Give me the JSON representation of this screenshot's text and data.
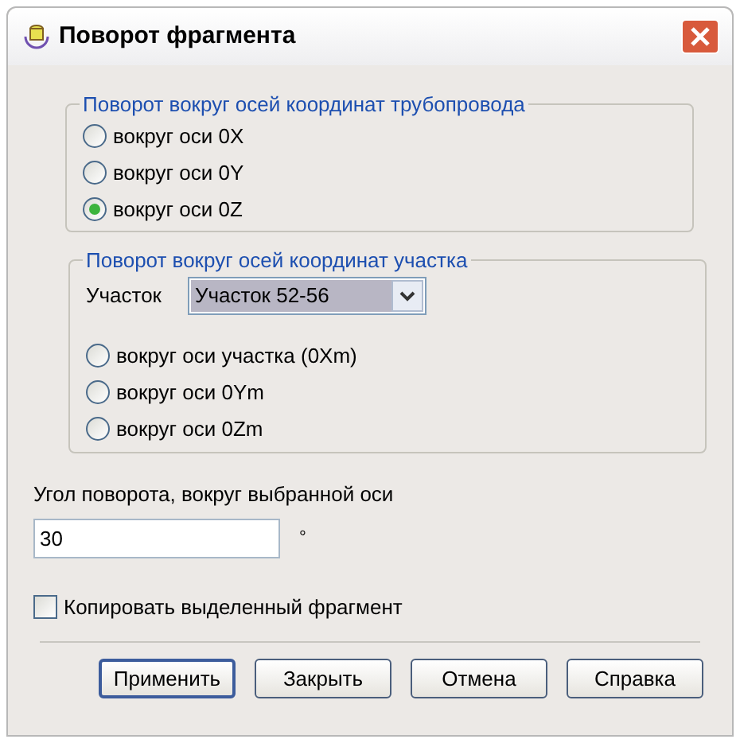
{
  "window": {
    "title": "Поворот фрагмента"
  },
  "pipe_group": {
    "title": "Поворот вокруг осей координат трубопровода",
    "options": [
      {
        "label": "вокруг оси 0X",
        "selected": false
      },
      {
        "label": "вокруг оси 0Y",
        "selected": false
      },
      {
        "label": "вокруг оси 0Z",
        "selected": true
      }
    ]
  },
  "segment_group": {
    "title": "Поворот вокруг осей координат участка",
    "segment_label": "Участок",
    "segment_value": "Участок 52-56",
    "options": [
      {
        "label": "вокруг оси участка (0Xm)",
        "selected": false
      },
      {
        "label": "вокруг оси 0Ym",
        "selected": false
      },
      {
        "label": "вокруг оси 0Zm",
        "selected": false
      }
    ]
  },
  "angle": {
    "label": "Угол поворота, вокруг выбранной оси",
    "value": "30",
    "unit": "°"
  },
  "copy": {
    "label": "Копировать выделенный фрагмент",
    "checked": false
  },
  "buttons": [
    {
      "label": "Применить",
      "default": true
    },
    {
      "label": "Закрыть",
      "default": false
    },
    {
      "label": "Отмена",
      "default": false
    },
    {
      "label": "Справка",
      "default": false
    }
  ]
}
